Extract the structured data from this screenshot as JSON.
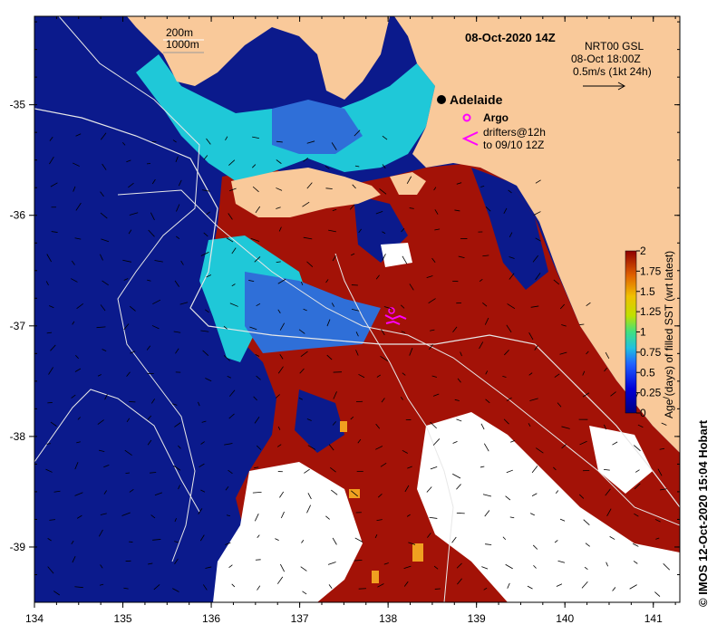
{
  "map": {
    "title": "08-Oct-2020 14Z",
    "lon_ticks": [
      "134",
      "135",
      "136",
      "137",
      "138",
      "139",
      "140",
      "141"
    ],
    "lat_ticks": [
      "-35",
      "-36",
      "-37",
      "-38",
      "-39"
    ],
    "lon_range": [
      134,
      141.3
    ],
    "lat_range": [
      -39.5,
      -34.2
    ]
  },
  "depth_legend": {
    "line1": "200m",
    "line2": "1000m"
  },
  "current_legend": {
    "line1": "NRT00 GSL",
    "line2": "08-Oct 18:00Z",
    "line3": "0.5m/s (1kt 24h)"
  },
  "markers": {
    "city": "Adelaide",
    "argo": "Argo",
    "drifters_line1": "drifters@12h",
    "drifters_line2": "to 09/10 12Z"
  },
  "colorbar": {
    "label": "Age (days) of filled SST (wrt latest)",
    "ticks": [
      "2",
      "1.75",
      "1.5",
      "1.25",
      "1",
      "0.75",
      "0.5",
      "0.25",
      "0"
    ],
    "range": [
      0,
      2
    ]
  },
  "credit": "© IMOS 12-Oct-2020 15:04 Hobart",
  "colors": {
    "land": "#f9c99a",
    "deep_blue": "#0b1a8c",
    "dark_red": "#a31207",
    "cyan": "#1fc8d8",
    "mid_blue": "#2f6fd8",
    "no_data": "#ffffff",
    "magenta": "#ff00ff",
    "orange": "#f0a020"
  }
}
